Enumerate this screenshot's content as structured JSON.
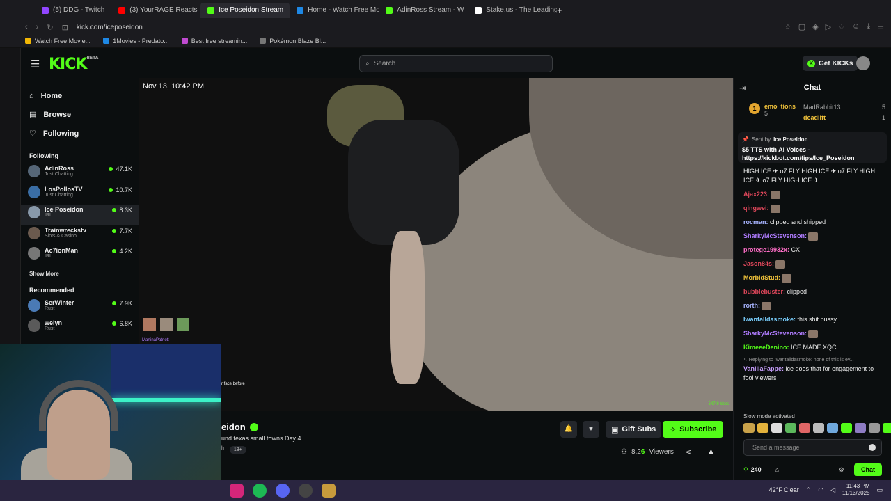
{
  "browser": {
    "tabs": [
      {
        "label": "(5) DDG - Twitch",
        "color": "#9146ff"
      },
      {
        "label": "(3) YourRAGE Reacts",
        "color": "#ff0000"
      },
      {
        "label": "Ice Poseidon Stream",
        "color": "#53fc18",
        "active": true
      },
      {
        "label": "Home - Watch Free Movies",
        "color": "#1e88e5"
      },
      {
        "label": "AdinRoss Stream - W",
        "color": "#53fc18"
      },
      {
        "label": "Stake.us - The Leading So",
        "color": "#ffffff"
      }
    ],
    "url": "kick.com/iceposeidon",
    "bookmarks": [
      {
        "label": "Watch Free Movie...",
        "color": "#f2b705"
      },
      {
        "label": "1Movies - Predato...",
        "color": "#1e88e5"
      },
      {
        "label": "Best free streamin...",
        "color": "#c04ad0"
      },
      {
        "label": "Pokémon Blaze Bl...",
        "color": "#777777"
      }
    ]
  },
  "header": {
    "logo": "KICK",
    "logo_beta": "BETA",
    "search_placeholder": "Search",
    "get_kicks": "Get KICKs"
  },
  "sidebar": {
    "nav": [
      {
        "icon": "home-icon",
        "glyph": "⌂",
        "label": "Home"
      },
      {
        "icon": "browse-icon",
        "glyph": "▤",
        "label": "Browse"
      },
      {
        "icon": "heart-icon",
        "glyph": "♡",
        "label": "Following"
      }
    ],
    "following_heading": "Following",
    "following": [
      {
        "name": "AdinRoss",
        "category": "Just Chatting",
        "viewers": "47.1K",
        "color": "#556677"
      },
      {
        "name": "LosPollosTV",
        "category": "Just Chatting",
        "viewers": "10.7K",
        "color": "#3a6ea5"
      },
      {
        "name": "Ice Poseidon",
        "category": "IRL",
        "viewers": "8.3K",
        "color": "#8899aa",
        "active": true
      },
      {
        "name": "Trainwreckstv",
        "category": "Slots & Casino",
        "viewers": "7.7K",
        "color": "#6b5a4e"
      },
      {
        "name": "Ac7ionMan",
        "category": "IRL",
        "viewers": "4.2K",
        "color": "#777777"
      }
    ],
    "show_more": "Show More",
    "recommended_heading": "Recommended",
    "recommended": [
      {
        "name": "SerWinter",
        "category": "Rust",
        "viewers": "7.9K",
        "color": "#4a7ab5"
      },
      {
        "name": "welyn",
        "category": "Rust",
        "viewers": "6.8K",
        "color": "#5a5a5a"
      }
    ]
  },
  "video": {
    "timestamp": "Nov 13, 10:42 PM",
    "bitrate": "547.9 kbps",
    "overlay_user": "MartinaPatriot:",
    "overlay_text": "r face before"
  },
  "stream_info": {
    "title": "eidon",
    "subtitle": "und texas small towns Day 4",
    "tag_left": "h",
    "tag_age": "18+",
    "gift_subs": "Gift Subs",
    "subscribe": "Subscribe",
    "viewers_prefix": "8,2",
    "viewers_suffix": "6",
    "viewers_label": "Viewers"
  },
  "chat": {
    "title": "Chat",
    "leaderboard": {
      "first_name": "emo_tions",
      "first_count": "5",
      "first_rank": "1",
      "second_name": "MadRabbit13...",
      "second_count": "5",
      "third_name": "deadlift",
      "third_count": "1"
    },
    "pinned": {
      "sent_by_label": "Sent by",
      "sender": "Ice Poseidon",
      "message": "$5 TTS with AI Voices -",
      "link": "https://kickbot.com/tips/Ice_Poseidon"
    },
    "messages": [
      {
        "user": "",
        "text": "HIGH ICE ✈ o7 FLY HIGH ICE ✈ o7 FLY HIGH ICE ✈ o7 FLY HIGH ICE ✈",
        "color": "#eeeeee"
      },
      {
        "user": "Ajax223:",
        "text": "",
        "color": "#e0475b",
        "emote": true
      },
      {
        "user": "qingwei:",
        "text": "",
        "color": "#e0475b",
        "emote": true
      },
      {
        "user": "rocman:",
        "text": "clipped and shipped",
        "color": "#a7b4ff"
      },
      {
        "user": "SharkyMcStevenson:",
        "text": "",
        "color": "#b07cff",
        "emote": true
      },
      {
        "user": "protege19932x:",
        "text": "CX",
        "color": "#ff6ec7"
      },
      {
        "user": "Jason84s:",
        "text": "",
        "color": "#e0475b",
        "emote": true
      },
      {
        "user": "MorbidStud:",
        "text": "",
        "color": "#f3c43b",
        "emote": true
      },
      {
        "user": "bubblebuster:",
        "text": "clipped",
        "color": "#e0475b"
      },
      {
        "user": "rorth:",
        "text": "",
        "color": "#a7b4ff",
        "emote": true
      },
      {
        "user": "Iwantalldasmoke:",
        "text": "this shit pussy",
        "color": "#7ad0ff"
      },
      {
        "user": "SharkyMcStevenson:",
        "text": "",
        "color": "#b07cff",
        "emote": true
      },
      {
        "user": "KimeeeDenino:",
        "text": "ICE MADE XQC",
        "color": "#53fc18"
      }
    ],
    "reply_note": "Replying to Iwantalldasmoke: none of this is ev...",
    "reply_message": {
      "user": "VanillaFappe:",
      "text": "ice does that for engagement to fool viewers",
      "color": "#c9a0ff"
    },
    "slow_mode": "Slow mode activated",
    "input_placeholder": "Send a message",
    "points": "240",
    "chat_button": "Chat"
  },
  "taskbar": {
    "weather": "42°F  Clear",
    "time": "11:43 PM",
    "date": "11/13/2025"
  }
}
